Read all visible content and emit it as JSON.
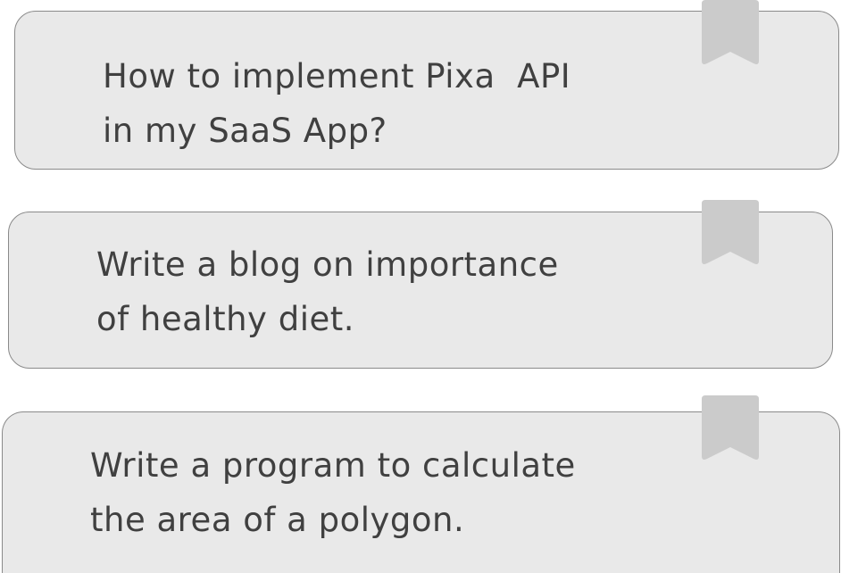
{
  "prompts": [
    {
      "text": "How to implement Pixa  API\nin my SaaS App?"
    },
    {
      "text": "Write a blog on importance\nof healthy diet."
    },
    {
      "text": "Write a program to calculate\nthe area of a polygon."
    }
  ],
  "icons": {
    "bookmark": "bookmark-icon",
    "bookmark_color": "#cbcbcb"
  },
  "colors": {
    "card_background": "#e9e9e9",
    "card_border": "#8a8a8a",
    "text": "#404040"
  }
}
